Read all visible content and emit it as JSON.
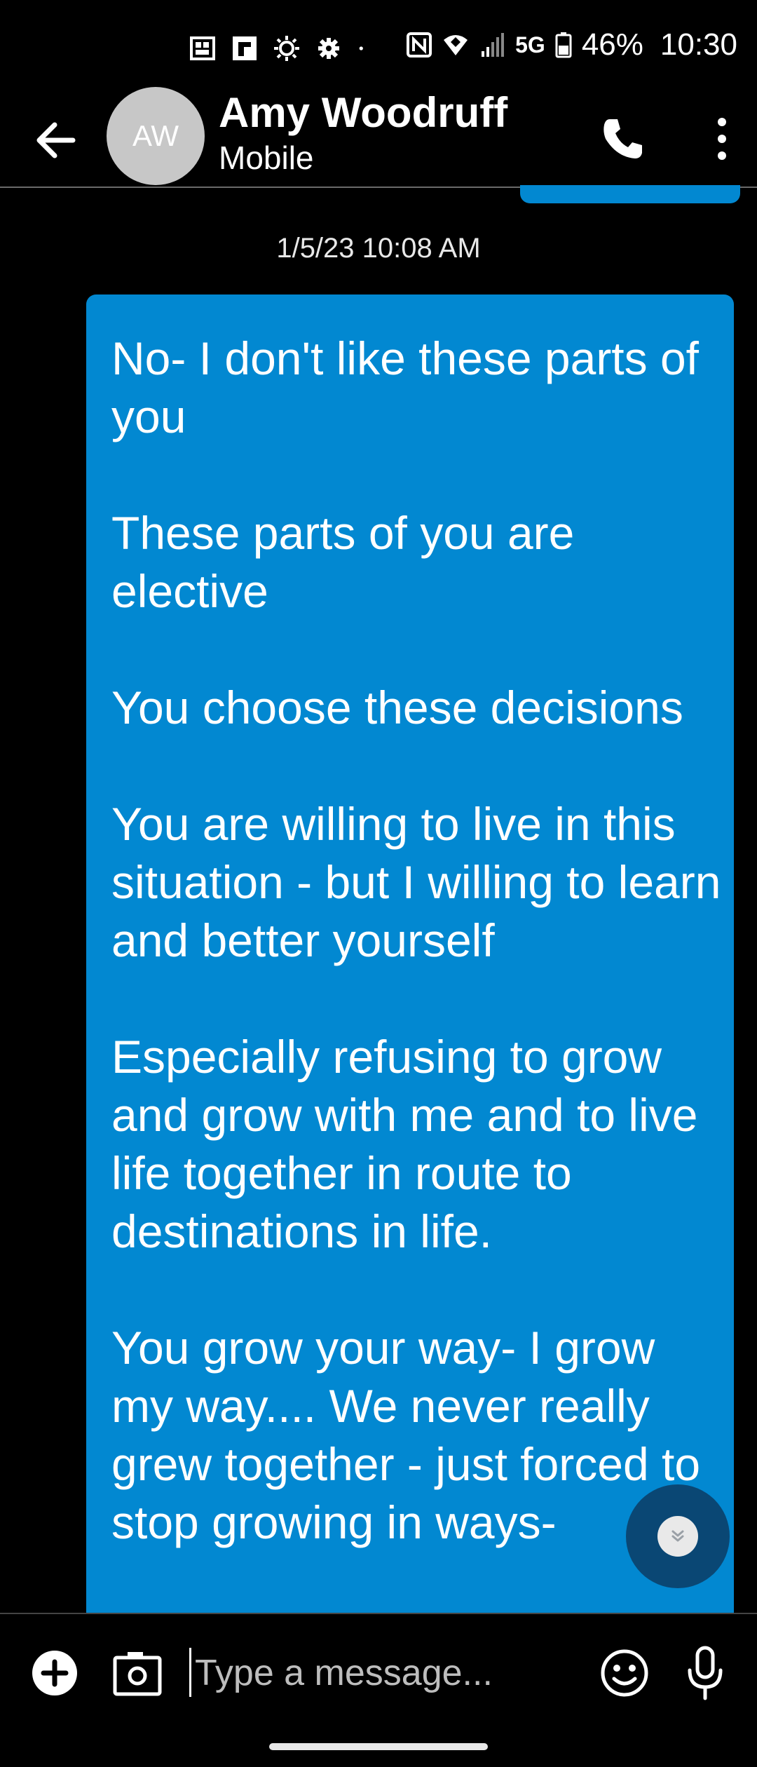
{
  "status_bar": {
    "network": "5G",
    "battery": "46%",
    "time": "10:30"
  },
  "header": {
    "avatar_initials": "AW",
    "contact_name": "Amy Woodruff",
    "contact_sub": "Mobile"
  },
  "conversation": {
    "timestamp": "1/5/23 10:08 AM",
    "message": "No- I don't like these parts of you\n\nThese parts of you are elective\n\nYou choose these decisions\n\nYou are willing to live in this situation - but I willing to learn and better yourself\n\nEspecially refusing to grow and grow with me and to live life together in route to destinations in life.\n\nYou grow your way- I grow my way.... We never really grew together - just forced to stop growing in ways-"
  },
  "composer": {
    "placeholder": "Type a message..."
  },
  "colors": {
    "bubble": "#0288d1",
    "background": "#000000",
    "avatar": "#c7c7c7"
  }
}
